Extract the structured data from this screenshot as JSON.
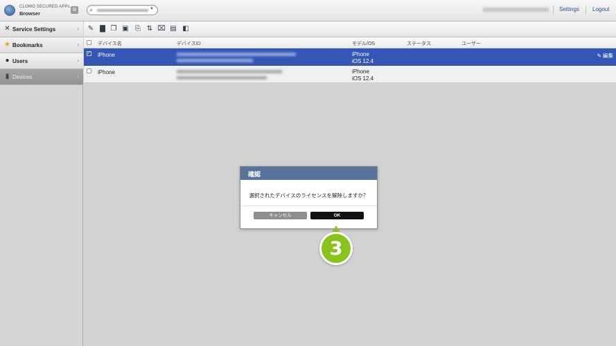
{
  "header": {
    "brand_line1": "CLOMO SECURED APPs",
    "brand_line2": "Browser",
    "org_button": "☒",
    "search_icon": "search-icon",
    "settings_label": "Settings",
    "logout_label": "Logout"
  },
  "sidebar": {
    "items": [
      {
        "label": "Service Settings",
        "icon": "tools-icon",
        "glyph": "✕"
      },
      {
        "label": "Bookmarks",
        "icon": "star-icon",
        "glyph": "★"
      },
      {
        "label": "Users",
        "icon": "user-icon",
        "glyph": "●"
      },
      {
        "label": "Devices",
        "icon": "device-icon",
        "glyph": "▮"
      }
    ]
  },
  "toolbar": {
    "icons": [
      "pencil-icon",
      "trash-icon",
      "copy-icon",
      "device-lock-icon",
      "device-send-icon",
      "transfer-icon",
      "device-wipe-icon",
      "device-settings-icon",
      "device-export-icon"
    ]
  },
  "table": {
    "headers": {
      "name": "デバイス名",
      "device_id": "デバイスID",
      "model": "モデル/OS",
      "status": "ステータス",
      "user": "ユーザー"
    },
    "rows": [
      {
        "name": "iPhone",
        "model": "iPhone",
        "os": "iOS 12.4",
        "selected": true,
        "edit_label": "編集"
      },
      {
        "name": "iPhone",
        "model": "iPhone",
        "os": "iOS 12.4",
        "selected": false
      }
    ]
  },
  "dialog": {
    "title": "確認",
    "message": "選択されたデバイスのライセンスを解除しますか？",
    "cancel_label": "キャンセル",
    "ok_label": "OK"
  },
  "step_marker": "3",
  "colors": {
    "selected_row": "#3457b6",
    "dialog_header": "#57739c",
    "ok_button": "#111111",
    "cancel_button": "#8e8e8e",
    "marker": "#8bc31d",
    "link": "#2b4f87"
  }
}
